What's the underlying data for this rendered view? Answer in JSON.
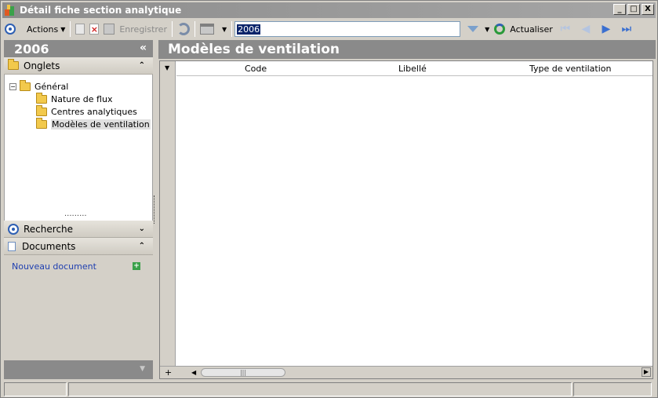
{
  "window": {
    "title": "Détail fiche section analytique",
    "buttons": [
      "_",
      "□",
      "X"
    ]
  },
  "toolbar": {
    "actions_label": "Actions",
    "save_label": "Enregistrer",
    "search_value": "2006",
    "refresh_label": "Actualiser"
  },
  "left": {
    "header_title": "2006",
    "tabs_section": "Onglets",
    "tree": {
      "root": "Général",
      "children": [
        "Nature de flux",
        "Centres analytiques",
        "Modèles de ventilation"
      ],
      "selected": "Modèles de ventilation"
    },
    "search_section": "Recherche",
    "documents_section": "Documents",
    "new_document": "Nouveau document"
  },
  "main": {
    "title": "Modèles de ventilation",
    "columns": [
      "Code",
      "Libellé",
      "Type de ventilation"
    ]
  },
  "colors": {
    "header_gray": "#8a8a8a",
    "accent_blue": "#2e5fb3",
    "link_blue": "#1f3fb0"
  }
}
